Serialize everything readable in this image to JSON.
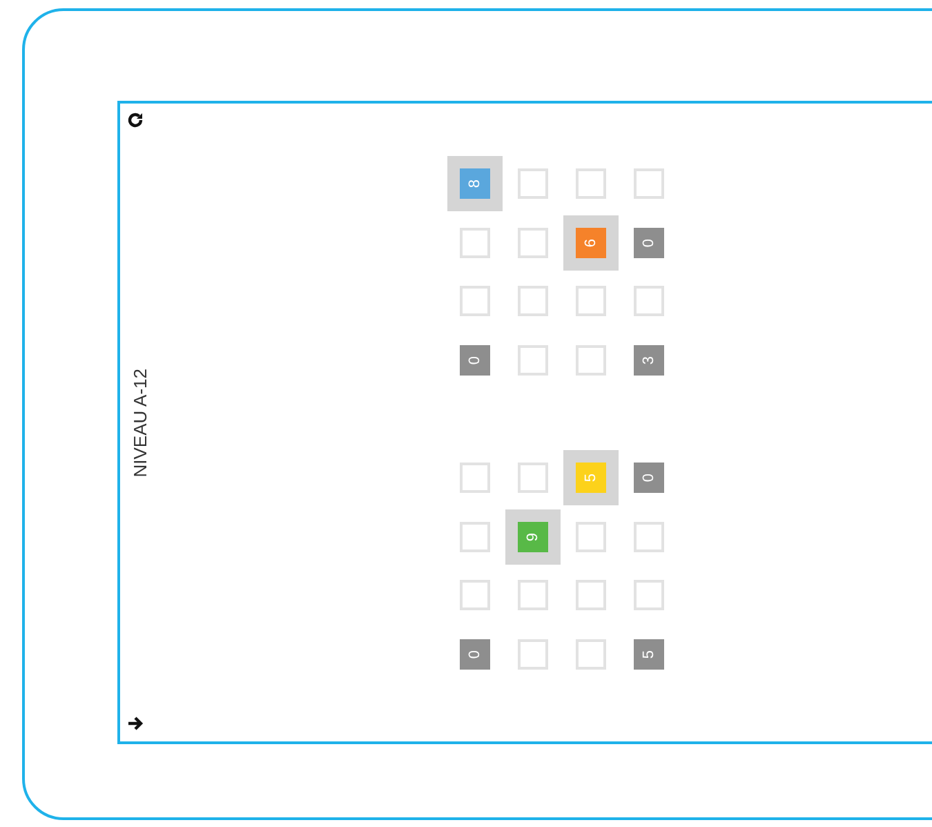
{
  "level_label": "NIVEAU A-12",
  "grids": [
    {
      "rows": [
        [
          {
            "kind": "colored",
            "value": "8",
            "color": "#5aa7dd",
            "selected": true
          },
          {
            "kind": "empty",
            "selected": false
          },
          {
            "kind": "empty",
            "selected": false
          },
          {
            "kind": "empty",
            "selected": false
          }
        ],
        [
          {
            "kind": "empty",
            "selected": false
          },
          {
            "kind": "empty",
            "selected": false
          },
          {
            "kind": "colored",
            "value": "6",
            "color": "#f5822a",
            "selected": true
          },
          {
            "kind": "given",
            "value": "0",
            "selected": false
          }
        ],
        [
          {
            "kind": "empty",
            "selected": false
          },
          {
            "kind": "empty",
            "selected": false
          },
          {
            "kind": "empty",
            "selected": false
          },
          {
            "kind": "empty",
            "selected": false
          }
        ],
        [
          {
            "kind": "given",
            "value": "0",
            "selected": false
          },
          {
            "kind": "empty",
            "selected": false
          },
          {
            "kind": "empty",
            "selected": false
          },
          {
            "kind": "given",
            "value": "3",
            "selected": false
          }
        ]
      ]
    },
    {
      "rows": [
        [
          {
            "kind": "empty",
            "selected": false
          },
          {
            "kind": "empty",
            "selected": false
          },
          {
            "kind": "colored",
            "value": "5",
            "color": "#fcd21b",
            "selected": true
          },
          {
            "kind": "given",
            "value": "0",
            "selected": false
          }
        ],
        [
          {
            "kind": "empty",
            "selected": false
          },
          {
            "kind": "colored",
            "value": "9",
            "color": "#58b947",
            "selected": true
          },
          {
            "kind": "empty",
            "selected": false
          },
          {
            "kind": "empty",
            "selected": false
          }
        ],
        [
          {
            "kind": "empty",
            "selected": false
          },
          {
            "kind": "empty",
            "selected": false
          },
          {
            "kind": "empty",
            "selected": false
          },
          {
            "kind": "empty",
            "selected": false
          }
        ],
        [
          {
            "kind": "given",
            "value": "0",
            "selected": false
          },
          {
            "kind": "empty",
            "selected": false
          },
          {
            "kind": "empty",
            "selected": false
          },
          {
            "kind": "given",
            "value": "5",
            "selected": false
          }
        ]
      ]
    }
  ]
}
